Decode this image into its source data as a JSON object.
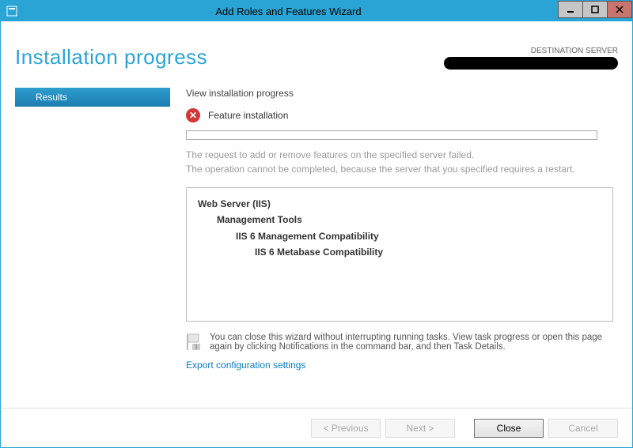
{
  "titlebar": {
    "title": "Add Roles and Features Wizard"
  },
  "header": {
    "heading": "Installation progress",
    "destination_label": "DESTINATION SERVER"
  },
  "sidebar": {
    "items": [
      {
        "label": "Results",
        "active": true
      }
    ]
  },
  "main": {
    "view_label": "View installation progress",
    "status_text": "Feature installation",
    "error_line1": "The request to add or remove features on the specified server failed.",
    "error_line2": "The operation cannot be completed, because the server that you specified requires a restart.",
    "features": {
      "l0": "Web Server (IIS)",
      "l1": "Management Tools",
      "l2": "IIS 6 Management Compatibility",
      "l3": "IIS 6 Metabase Compatibility"
    },
    "note_text": "You can close this wizard without interrupting running tasks. View task progress or open this page again by clicking Notifications in the command bar, and then Task Details.",
    "export_link": "Export configuration settings"
  },
  "footer": {
    "previous": "<  Previous",
    "next": "Next  >",
    "close": "Close",
    "cancel": "Cancel"
  }
}
